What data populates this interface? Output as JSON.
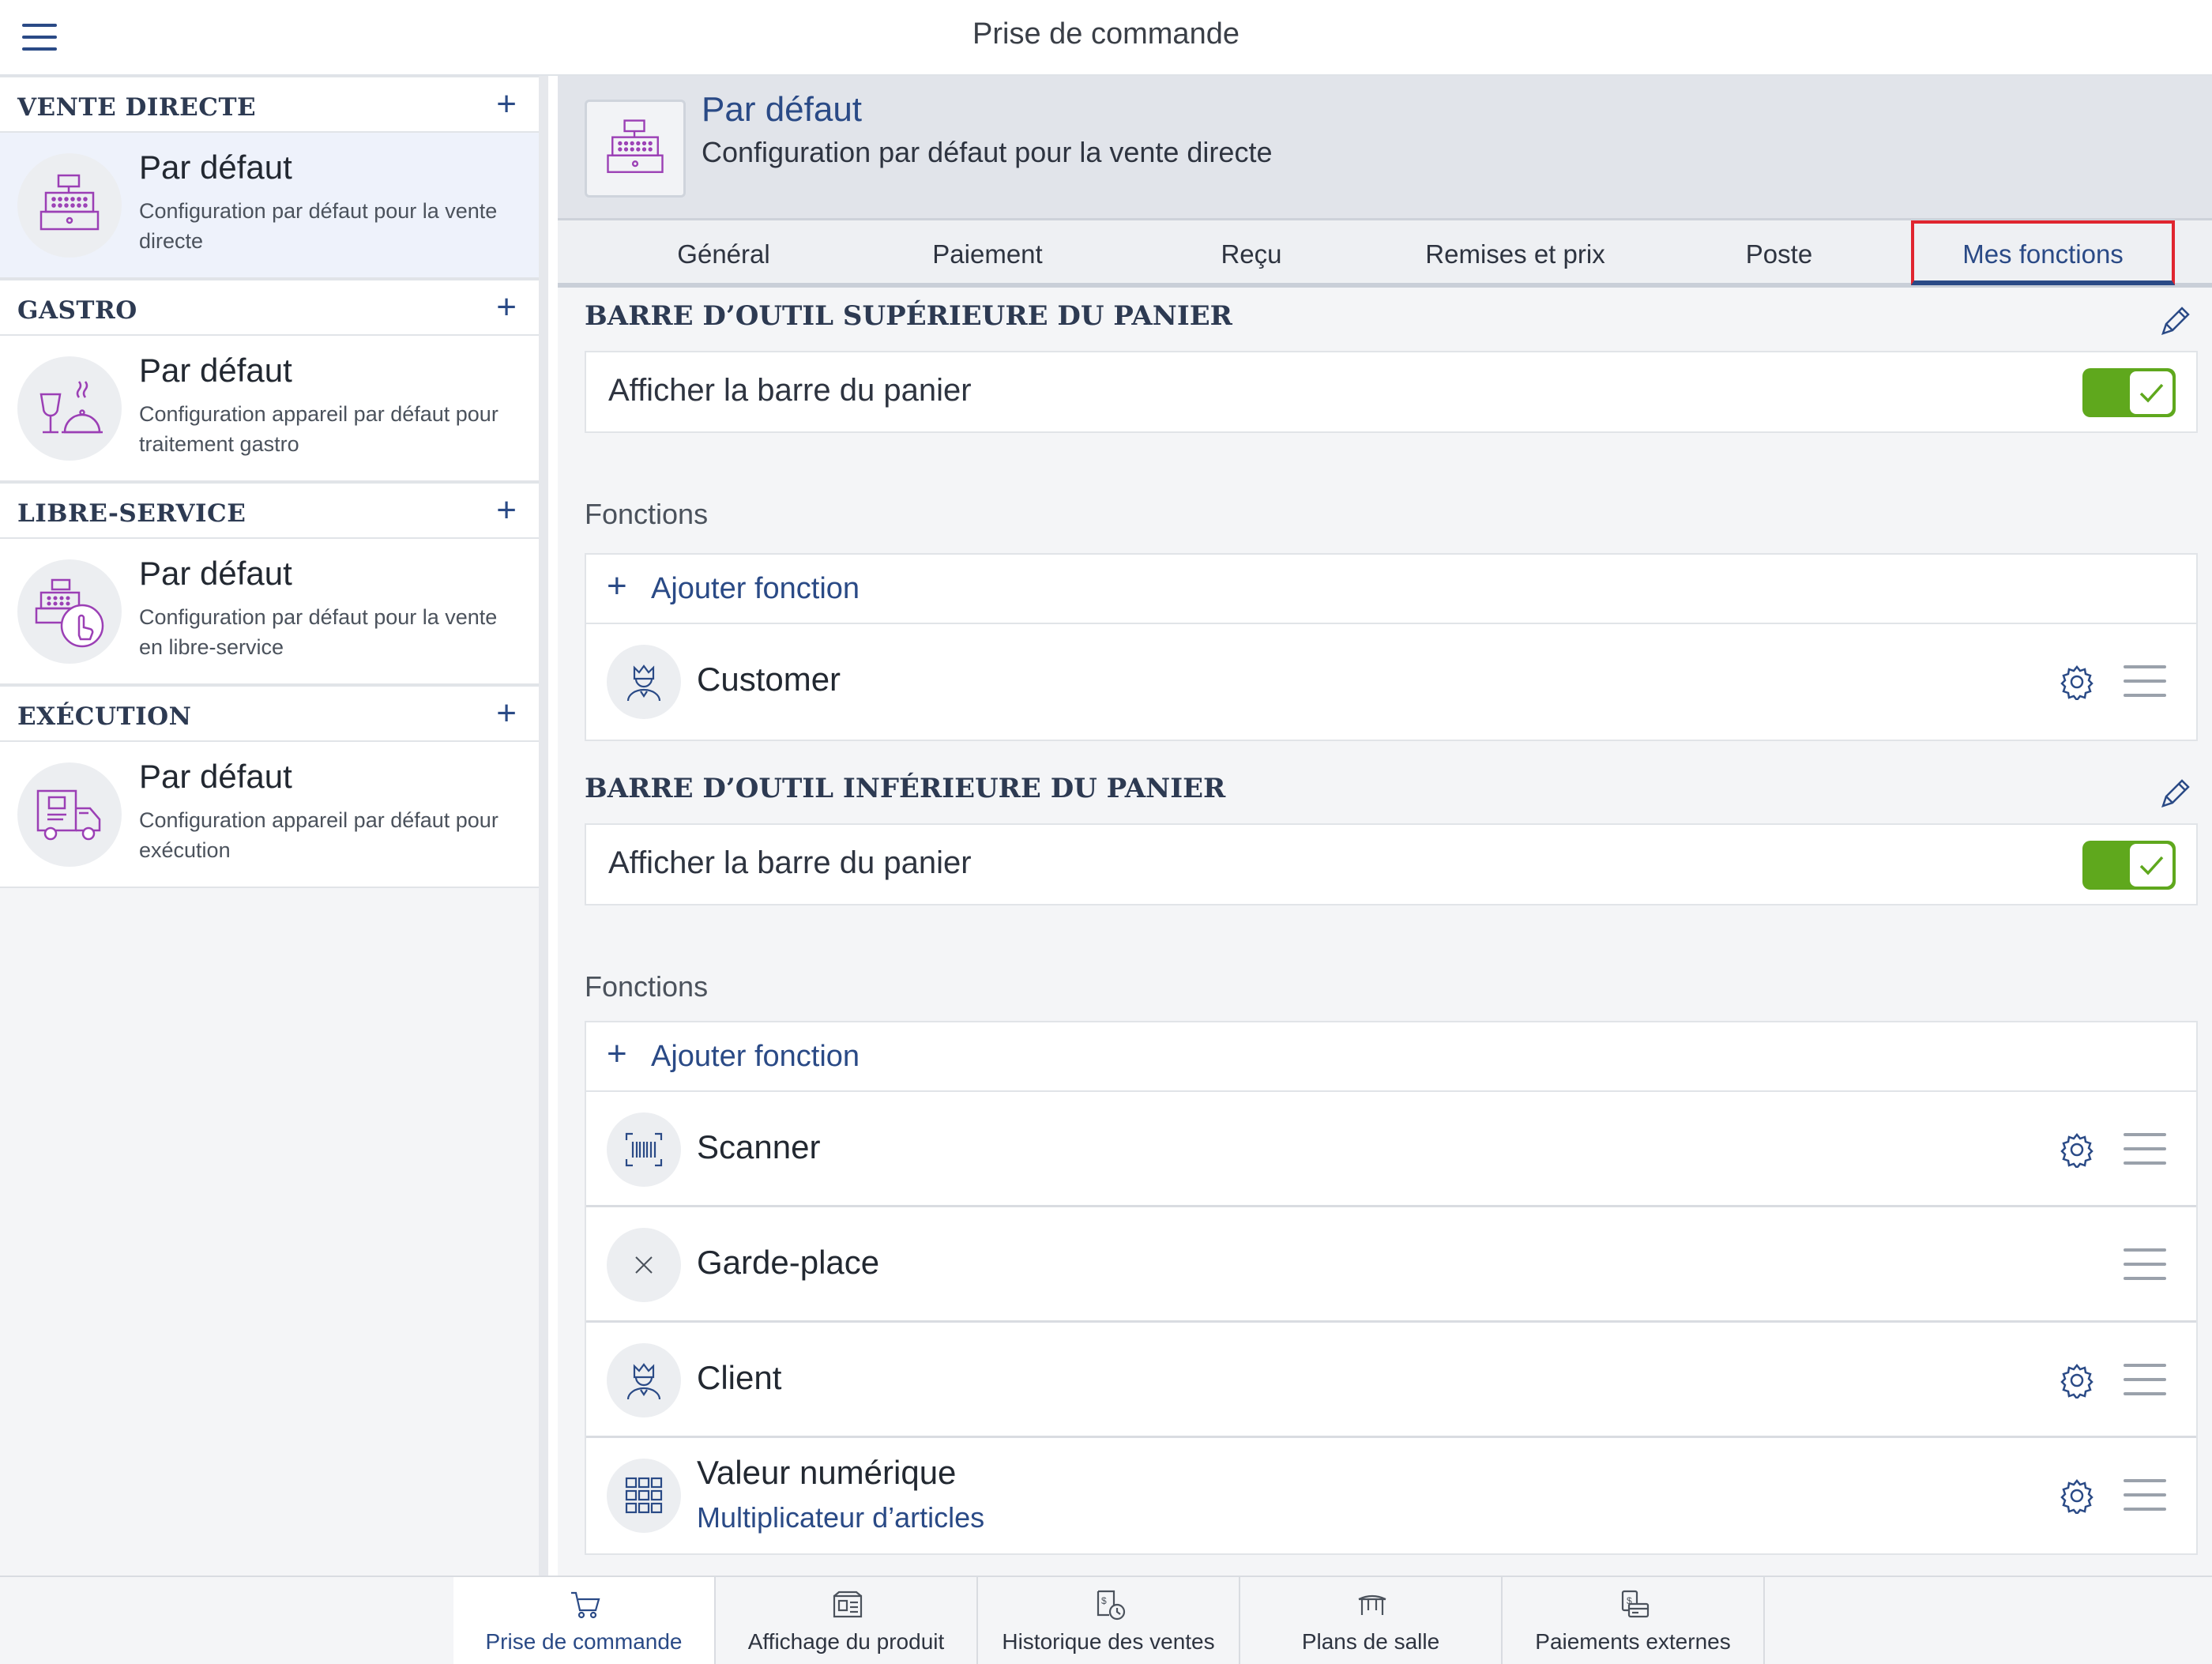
{
  "header": {
    "title": "Prise de commande"
  },
  "sidebar": {
    "sections": [
      {
        "title": "VENTE DIRECTE",
        "item": {
          "name": "Par défaut",
          "desc": "Configuration par défaut pour la vente directe",
          "icon": "cash-register-icon"
        }
      },
      {
        "title": "GASTRO",
        "item": {
          "name": "Par défaut",
          "desc": "Configuration appareil par défaut pour traitement gastro",
          "icon": "gastro-icon"
        }
      },
      {
        "title": "LIBRE-SERVICE",
        "item": {
          "name": "Par défaut",
          "desc": "Configuration par défaut pour la vente en libre-service",
          "icon": "self-service-icon"
        }
      },
      {
        "title": "EXÉCUTION",
        "item": {
          "name": "Par défaut",
          "desc": "Configuration appareil par défaut pour exécution",
          "icon": "delivery-truck-icon"
        }
      }
    ]
  },
  "main": {
    "title": "Par défaut",
    "subtitle": "Configuration par défaut pour la vente directe",
    "tabs": [
      {
        "label": "Général"
      },
      {
        "label": "Paiement"
      },
      {
        "label": "Reçu"
      },
      {
        "label": "Remises et prix"
      },
      {
        "label": "Poste"
      },
      {
        "label": "Mes fonctions"
      }
    ],
    "active_tab": "Mes fonctions",
    "top_toolbar": {
      "title": "BARRE D’OUTIL SUPÉRIEURE DU PANIER",
      "toggle_label": "Afficher la barre du panier",
      "toggle_on": true,
      "functions_caption": "Fonctions",
      "add_label": "Ajouter fonction",
      "functions": [
        {
          "name": "Customer",
          "icon": "customer-icon",
          "has_settings": true
        }
      ]
    },
    "bottom_toolbar": {
      "title": "BARRE D’OUTIL INFÉRIEURE DU PANIER",
      "toggle_label": "Afficher la barre du panier",
      "toggle_on": true,
      "functions_caption": "Fonctions",
      "add_label": "Ajouter fonction",
      "functions": [
        {
          "name": "Scanner",
          "icon": "barcode-scanner-icon",
          "has_settings": true
        },
        {
          "name": "Garde-place",
          "icon": "placeholder-x-icon",
          "has_settings": false
        },
        {
          "name": "Client",
          "icon": "customer-icon",
          "has_settings": true
        },
        {
          "name": "Valeur numérique",
          "sub": "Multiplicateur d’articles",
          "icon": "numeric-keypad-icon",
          "has_settings": true
        }
      ]
    }
  },
  "bottom_nav": [
    {
      "label": "Prise de commande",
      "icon": "cart-icon"
    },
    {
      "label": "Affichage du produit",
      "icon": "product-display-icon"
    },
    {
      "label": "Historique des ventes",
      "icon": "sales-history-icon"
    },
    {
      "label": "Plans de salle",
      "icon": "floor-plan-table-icon"
    },
    {
      "label": "Paiements externes",
      "icon": "external-payments-icon"
    }
  ],
  "colors": {
    "accent": "#2a4a86",
    "toggle_on": "#5fa81d",
    "highlight_box": "#e0252f",
    "icon_purple": "#9b3fb5"
  }
}
